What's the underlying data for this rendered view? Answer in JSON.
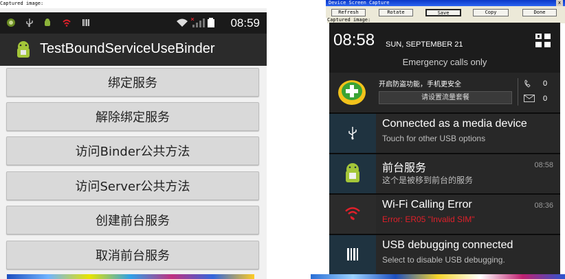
{
  "left_capture_label": "Captured image:",
  "left_phone": {
    "status_time": "08:59",
    "app_title": "TestBoundServiceUseBinder",
    "buttons": [
      {
        "label": "绑定服务"
      },
      {
        "label": "解除绑定服务"
      },
      {
        "label": "访问Binder公共方法"
      },
      {
        "label": "访问Server公共方法"
      },
      {
        "label": "创建前台服务"
      },
      {
        "label": "取消前台服务"
      }
    ]
  },
  "right_capture": {
    "window_title": "Device Screen Capture",
    "close_label": "x",
    "toolbar": {
      "refresh": "Refresh",
      "rotate": "Rotate",
      "save": "Save",
      "copy": "Copy",
      "done": "Done"
    },
    "captured_label": "Captured image:"
  },
  "right_phone": {
    "time": "08:58",
    "date": "SUN, SEPTEMBER 21",
    "emergency": "Emergency calls only",
    "security": {
      "line1": "开启防盗功能，手机更安全",
      "button": "请设置流量套餐",
      "missed_calls": "0",
      "messages": "0"
    },
    "notifications": [
      {
        "title": "Connected as a media device",
        "subtitle": "Touch for other USB options",
        "time": "",
        "icon": "usb-icon"
      },
      {
        "title": "前台服务",
        "subtitle": "这个是被移到前台的服务",
        "time": "08:58",
        "icon": "android-icon"
      },
      {
        "title": "Wi-Fi Calling Error",
        "subtitle": "Error: ER05 \"Invalid SIM\"",
        "time": "08:36",
        "icon": "wifi-calling-error-icon"
      },
      {
        "title": "USB debugging connected",
        "subtitle": "Select to disable USB debugging.",
        "time": "",
        "icon": "usb-debug-icon"
      }
    ]
  },
  "colors": {
    "error_red": "#e0202a",
    "android_green": "#9acd32",
    "notification_icon_bg": "#1f3340"
  }
}
